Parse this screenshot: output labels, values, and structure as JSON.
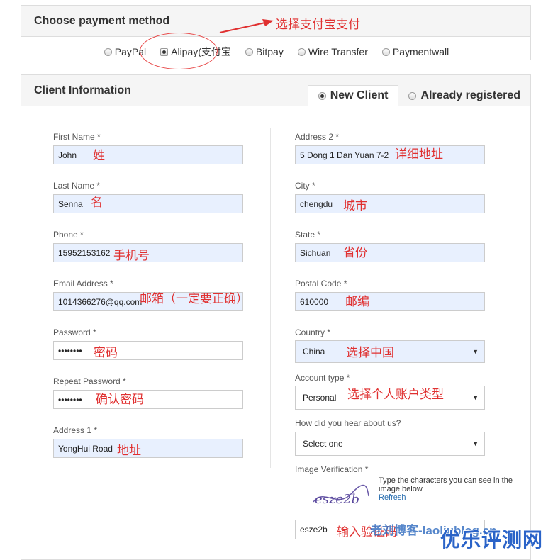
{
  "payment": {
    "title": "Choose payment method",
    "options": [
      {
        "label": "PayPal",
        "checked": false
      },
      {
        "label": "Alipay(支付宝",
        "checked": true
      },
      {
        "label": "Bitpay",
        "checked": false
      },
      {
        "label": "Wire Transfer",
        "checked": false
      },
      {
        "label": "Paymentwall",
        "checked": false
      }
    ],
    "annotation": "选择支付宝支付"
  },
  "client": {
    "title": "Client Information",
    "tabs": [
      "New Client",
      "Already registered"
    ],
    "left": {
      "first_name": {
        "label": "First Name *",
        "value": "John",
        "note": "姓"
      },
      "last_name": {
        "label": "Last Name *",
        "value": "Senna",
        "note": "名"
      },
      "phone": {
        "label": "Phone *",
        "value": "15952153162",
        "note": "手机号"
      },
      "email": {
        "label": "Email Address *",
        "value": "1014366276@qq.com",
        "note": "邮箱（一定要正确）"
      },
      "password": {
        "label": "Password *",
        "value": "••••••••",
        "note": "密码"
      },
      "repeat_password": {
        "label": "Repeat Password *",
        "value": "••••••••",
        "note": "确认密码"
      },
      "address1": {
        "label": "Address 1 *",
        "value": "YongHui Road",
        "note": "地址"
      }
    },
    "right": {
      "address2": {
        "label": "Address 2 *",
        "value": "5 Dong 1 Dan Yuan 7-2",
        "note": "详细地址"
      },
      "city": {
        "label": "City *",
        "value": "chengdu",
        "note": "城市"
      },
      "state": {
        "label": "State *",
        "value": "Sichuan",
        "note": "省份"
      },
      "postal": {
        "label": "Postal Code *",
        "value": "610000",
        "note": "邮编"
      },
      "country": {
        "label": "Country *",
        "value": "China",
        "note": "选择中国"
      },
      "account_type": {
        "label": "Account type *",
        "value": "Personal",
        "note": "选择个人账户类型"
      },
      "hear": {
        "label": "How did you hear about us?",
        "value": "Select one"
      },
      "verification": {
        "label": "Image Verification *",
        "help": "Type the characters you can see in the image below",
        "refresh": "Refresh",
        "captcha_image_text": "esze2b",
        "value": "esze2b",
        "note": "输入验证码"
      }
    }
  },
  "watermark": {
    "blog": "老刘博客-laoliublog.cn",
    "brand": "优乐评测网"
  },
  "colors": {
    "annotation": "#e03030",
    "autofill": "#e8f0fe",
    "panel_head": "#f5f5f5"
  }
}
